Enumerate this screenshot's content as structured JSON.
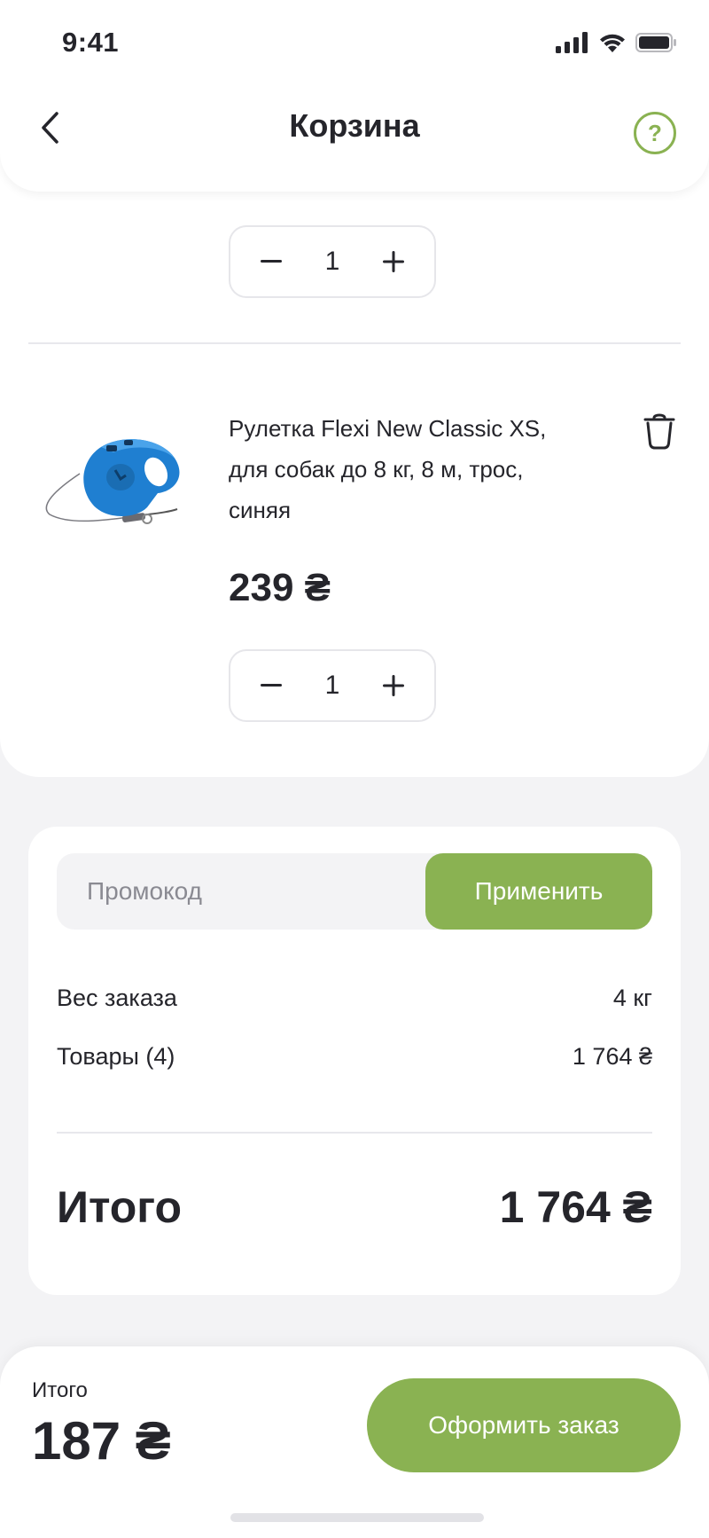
{
  "status_bar": {
    "time": "9:41",
    "icons": [
      "signal-icon",
      "wifi-icon",
      "battery-icon"
    ]
  },
  "header": {
    "title": "Корзина",
    "back_icon": "chevron-left-icon",
    "help_label": "?"
  },
  "cart": {
    "items": [
      {
        "quantity": "1"
      },
      {
        "name": "Рулетка Flexi New Classic XS, для собак до 8 кг, 8 м, трос, синяя",
        "price": "239 ₴",
        "quantity": "1",
        "image": "retractable-leash-image"
      }
    ]
  },
  "summary": {
    "promo_placeholder": "Промокод",
    "apply_label": "Применить",
    "weight_label": "Вес заказа",
    "weight_value": "4 кг",
    "goods_label": "Товары (4)",
    "goods_value": "1 764 ₴",
    "total_label": "Итого",
    "total_value": "1 764 ₴"
  },
  "bottom_bar": {
    "total_label": "Итого",
    "total_value": "187 ₴",
    "checkout_label": "Оформить заказ"
  },
  "colors": {
    "accent": "#8ab252",
    "text": "#25252b",
    "background": "#f3f3f5",
    "card": "#ffffff"
  }
}
